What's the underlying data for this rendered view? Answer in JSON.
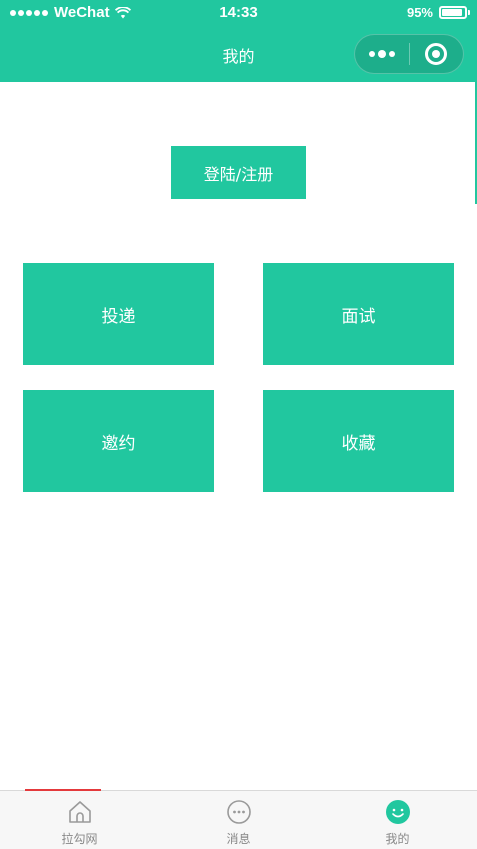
{
  "status_bar": {
    "carrier": "WeChat",
    "time": "14:33",
    "battery_percent": "95%"
  },
  "navbar": {
    "title": "我的",
    "capsule_icons": [
      "more-icon",
      "target-icon"
    ]
  },
  "main": {
    "login_label": "登陆/注册",
    "tiles": [
      {
        "label": "投递"
      },
      {
        "label": "面试"
      },
      {
        "label": "邀约"
      },
      {
        "label": "收藏"
      }
    ]
  },
  "tabbar": {
    "items": [
      {
        "label": "拉勾网",
        "icon": "home-icon"
      },
      {
        "label": "消息",
        "icon": "chat-icon"
      },
      {
        "label": "我的",
        "icon": "smile-icon",
        "active": true
      }
    ]
  },
  "colors": {
    "brand": "#21c79f",
    "tab_indicator": "#e4393c",
    "tab_inactive": "#888888"
  }
}
